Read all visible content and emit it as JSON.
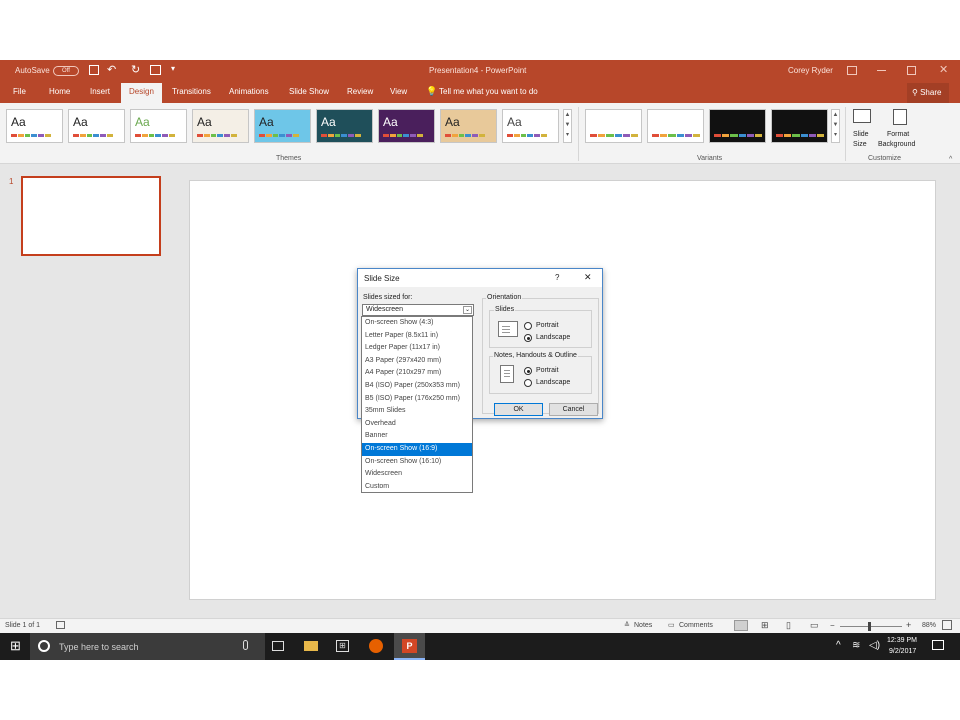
{
  "titlebar": {
    "autosave_label": "AutoSave",
    "autosave_state": "Off",
    "doc_title": "Presentation4  -  PowerPoint",
    "user": "Corey Ryder"
  },
  "tabs": [
    "File",
    "Home",
    "Insert",
    "Design",
    "Transitions",
    "Animations",
    "Slide Show",
    "Review",
    "View"
  ],
  "active_tab": "Design",
  "tell_me": "Tell me what you want to do",
  "share_label": "Share",
  "themes": [
    {
      "aa": "Aa",
      "bg": "#ffffff",
      "fg": "#222222"
    },
    {
      "aa": "Aa",
      "bg": "#ffffff",
      "fg": "#222222"
    },
    {
      "aa": "Aa",
      "bg": "#ffffff",
      "fg": "#6aa84f"
    },
    {
      "aa": "Aa",
      "bg": "#f4efe6",
      "fg": "#222222"
    },
    {
      "aa": "Aa",
      "bg": "#6ec6e8",
      "fg": "#222222"
    },
    {
      "aa": "Aa",
      "bg": "#1f4f5a",
      "fg": "#ffffff"
    },
    {
      "aa": "Aa",
      "bg": "#4a1f5c",
      "fg": "#ffffff"
    },
    {
      "aa": "Aa",
      "bg": "#e8c99a",
      "fg": "#222222"
    },
    {
      "aa": "Aa",
      "bg": "#ffffff",
      "fg": "#444444"
    }
  ],
  "themes_group_label": "Themes",
  "variants": [
    {
      "bg": "#ffffff"
    },
    {
      "bg": "#ffffff"
    },
    {
      "bg": "#111111"
    },
    {
      "bg": "#111111"
    }
  ],
  "variants_group_label": "Variants",
  "customize": {
    "slide_size_line1": "Slide",
    "slide_size_line2": "Size",
    "format_bg_line1": "Format",
    "format_bg_line2": "Background",
    "group_label": "Customize"
  },
  "thumbnails": {
    "slide_number": "1"
  },
  "dialog": {
    "title": "Slide Size",
    "help": "?",
    "close": "✕",
    "sized_for_label": "Slides sized for:",
    "sized_for_value": "Widescreen",
    "orientation_label": "Orientation",
    "slides_label": "Slides",
    "slides_portrait": "Portrait",
    "slides_landscape": "Landscape",
    "notes_label": "Notes, Handouts & Outline",
    "notes_portrait": "Portrait",
    "notes_landscape": "Landscape",
    "ok": "OK",
    "cancel": "Cancel",
    "options": [
      "On-screen Show (4:3)",
      "Letter Paper (8.5x11 in)",
      "Ledger Paper (11x17 in)",
      "A3 Paper (297x420 mm)",
      "A4 Paper (210x297 mm)",
      "B4 (ISO) Paper (250x353 mm)",
      "B5 (ISO) Paper (176x250 mm)",
      "35mm Slides",
      "Overhead",
      "Banner",
      "On-screen Show (16:9)",
      "On-screen Show (16:10)",
      "Widescreen",
      "Custom"
    ],
    "selected_option": "On-screen Show (16:9)"
  },
  "status": {
    "slide_of": "Slide 1 of 1",
    "notes": "Notes",
    "comments": "Comments",
    "zoom": "88%"
  },
  "taskbar": {
    "search_placeholder": "Type here to search",
    "time": "12:39 PM",
    "date": "9/2/2017"
  },
  "colors": {
    "accent": "#b7472a",
    "selection": "#0078d7"
  }
}
